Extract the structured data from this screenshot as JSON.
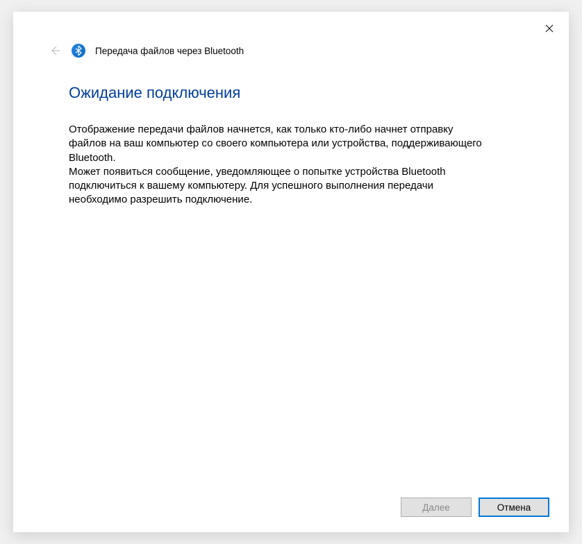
{
  "window": {
    "title": "Передача файлов через Bluetooth"
  },
  "main": {
    "heading": "Ожидание подключения",
    "paragraph": "Отображение передачи файлов начнется, как только кто-либо начнет отправку файлов на ваш компьютер со своего компьютера или устройства, поддерживающего Bluetooth.\nМожет появиться сообщение, уведомляющее о попытке устройства Bluetooth подключиться к вашему компьютеру. Для успешного выполнения передачи необходимо разрешить подключение."
  },
  "footer": {
    "next_label": "Далее",
    "cancel_label": "Отмена"
  }
}
